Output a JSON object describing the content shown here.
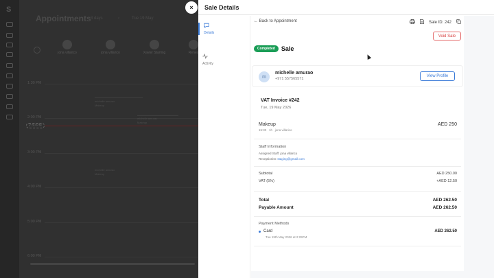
{
  "background": {
    "logo": "S",
    "title": "Appointments",
    "view": "3 days",
    "nav_arrow": "‹",
    "date": "Tue 19 May",
    "staff": [
      {
        "name": "jona villarico"
      },
      {
        "name": "jona villarico"
      },
      {
        "name": "Xavier Starling"
      },
      {
        "name": "Renes"
      }
    ],
    "times": [
      "1:30 PM",
      "2:00 PM",
      "2:30 PM",
      "3:00 PM",
      "4:00 PM",
      "5:00 PM",
      "6:00 PM"
    ],
    "now_label": "2:30 PM",
    "appointments": [
      {
        "title": "michelle amurao",
        "sub": "Makeup"
      },
      {
        "title": "michelle amurao",
        "sub": "Makeup"
      },
      {
        "title": "michelle amurao",
        "sub": "Makeup"
      }
    ]
  },
  "close_glyph": "×",
  "panel": {
    "title": "Sale Details",
    "tabs": [
      {
        "label": "Details",
        "icon": "chat-icon"
      },
      {
        "label": "Activity",
        "icon": "activity-icon"
      }
    ]
  },
  "sale": {
    "back_label": "← Back to Appointment",
    "sale_id": "Sale ID: 242",
    "void_label": "Void Sale",
    "status": "Completed",
    "heading": "Sale",
    "client": {
      "initial": "m",
      "name": "michelle amurao",
      "phone": "+971 557565571",
      "profile_label": "View Profile"
    },
    "invoice": {
      "title": "VAT Invoice #242",
      "date": "Tue, 19 May 2026"
    },
    "item": {
      "name": "Makeup",
      "meta": "15:30   1h   jona villarico",
      "price": "AED 250"
    },
    "staff_info": {
      "title": "Staff Information",
      "assigned_label": "Assigned Staff:",
      "assigned": "jona villarico",
      "receptionist_label": "Receptionist:",
      "receptionist": "staging@gmail.com"
    },
    "totals": {
      "subtotal_label": "Subtotal",
      "subtotal": "AED 250.00",
      "vat_label": "VAT (5%)",
      "vat": "+AED 12.50",
      "total_label": "Total",
      "total": "AED 262.50",
      "payable_label": "Payable Amount",
      "payable": "AED 262.50"
    },
    "payment": {
      "title": "Payment Methods",
      "method": "Card",
      "time": "Tue 19th May 2026 at 2:29PM",
      "amount": "AED 262.50"
    }
  },
  "colors": {
    "accent": "#3b7bd8",
    "completed": "#1a9d56",
    "danger": "#d84141"
  }
}
